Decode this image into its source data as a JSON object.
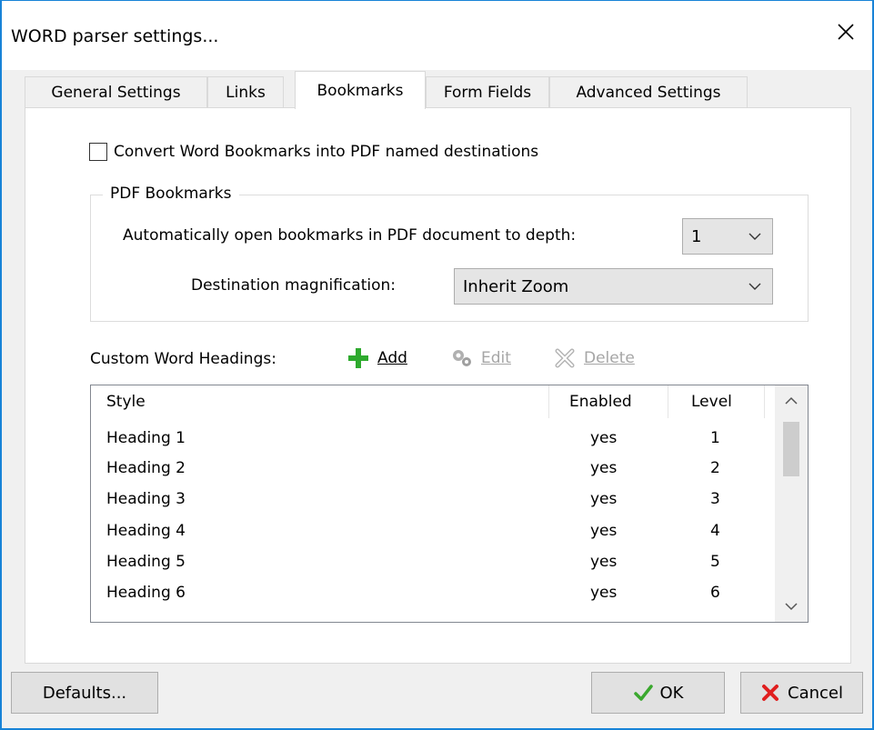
{
  "window": {
    "title": "WORD parser settings..."
  },
  "tabs": [
    {
      "label": "General Settings"
    },
    {
      "label": "Links"
    },
    {
      "label": "Bookmarks",
      "active": true
    },
    {
      "label": "Form Fields"
    },
    {
      "label": "Advanced Settings"
    }
  ],
  "bookmarks": {
    "convert_checkbox": {
      "label": "Convert Word Bookmarks into PDF named destinations",
      "checked": false
    },
    "pdf_group": {
      "legend": "PDF Bookmarks",
      "depth_label": "Automatically open bookmarks in PDF document to depth:",
      "depth_value": "1",
      "magnification_label": "Destination magnification:",
      "magnification_value": "Inherit Zoom"
    },
    "headings": {
      "label": "Custom Word Headings:",
      "add_label": "Add",
      "edit_label": "Edit",
      "delete_label": "Delete",
      "columns": {
        "style": "Style",
        "enabled": "Enabled",
        "level": "Level"
      },
      "rows": [
        {
          "style": "Heading 1",
          "enabled": "yes",
          "level": "1"
        },
        {
          "style": "Heading 2",
          "enabled": "yes",
          "level": "2"
        },
        {
          "style": "Heading 3",
          "enabled": "yes",
          "level": "3"
        },
        {
          "style": "Heading 4",
          "enabled": "yes",
          "level": "4"
        },
        {
          "style": "Heading 5",
          "enabled": "yes",
          "level": "5"
        },
        {
          "style": "Heading 6",
          "enabled": "yes",
          "level": "6"
        }
      ]
    }
  },
  "footer": {
    "defaults_label": "Defaults...",
    "ok_label": "OK",
    "cancel_label": "Cancel"
  },
  "colors": {
    "accent": "#1883d7",
    "add_green": "#2eaa2e",
    "cancel_red": "#e02020",
    "ok_green": "#3aa82e"
  }
}
